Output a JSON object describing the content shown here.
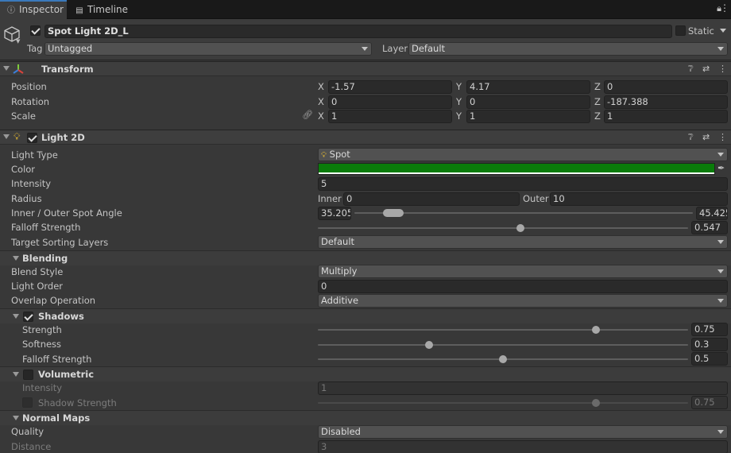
{
  "tabs": [
    {
      "label": "Inspector",
      "icon": "info-icon"
    },
    {
      "label": "Timeline",
      "icon": "film-icon"
    }
  ],
  "gameobject": {
    "name": "Spot Light 2D_L",
    "active": true,
    "static_label": "Static",
    "static": false,
    "tag_label": "Tag",
    "tag_value": "Untagged",
    "layer_label": "Layer",
    "layer_value": "Default"
  },
  "transform": {
    "title": "Transform",
    "rows": [
      {
        "label": "Position",
        "x": "-1.57",
        "y": "4.17",
        "z": "0"
      },
      {
        "label": "Rotation",
        "x": "0",
        "y": "0",
        "z": "-187.388"
      },
      {
        "label": "Scale",
        "x": "1",
        "y": "1",
        "z": "1"
      }
    ],
    "axis_labels": [
      "X",
      "Y",
      "Z"
    ]
  },
  "light2d": {
    "title": "Light 2D",
    "enabled": true,
    "light_type_label": "Light Type",
    "light_type_value": "Spot",
    "color_label": "Color",
    "color_hex": "#0a7c0a",
    "intensity_label": "Intensity",
    "intensity_value": "5",
    "radius_label": "Radius",
    "inner_label": "Inner",
    "inner_value": "0",
    "outer_label": "Outer",
    "outer_value": "10",
    "spot_angle_label": "Inner / Outer Spot Angle",
    "spot_inner": "35.205",
    "spot_outer": "45.425",
    "spot_range_fraction": [
      0.09,
      0.14
    ],
    "falloff_label": "Falloff Strength",
    "falloff_value": "0.547",
    "falloff_fraction": 0.547,
    "sorting_label": "Target Sorting Layers",
    "sorting_value": "Default"
  },
  "blending": {
    "title": "Blending",
    "blend_style_label": "Blend Style",
    "blend_style_value": "Multiply",
    "light_order_label": "Light Order",
    "light_order_value": "0",
    "overlap_label": "Overlap Operation",
    "overlap_value": "Additive"
  },
  "shadows": {
    "title": "Shadows",
    "enabled": true,
    "strength_label": "Strength",
    "strength_value": "0.75",
    "strength_fraction": 0.75,
    "softness_label": "Softness",
    "softness_value": "0.3",
    "softness_fraction": 0.3,
    "falloff_label": "Falloff Strength",
    "falloff_value": "0.5",
    "falloff_fraction": 0.5
  },
  "volumetric": {
    "title": "Volumetric",
    "enabled": false,
    "intensity_label": "Intensity",
    "intensity_value": "1",
    "shadow_strength_label": "Shadow Strength",
    "shadow_strength_value": "0.75",
    "shadow_strength_fraction": 0.75
  },
  "normal_maps": {
    "title": "Normal Maps",
    "quality_label": "Quality",
    "quality_value": "Disabled",
    "distance_label": "Distance",
    "distance_value": "3"
  }
}
